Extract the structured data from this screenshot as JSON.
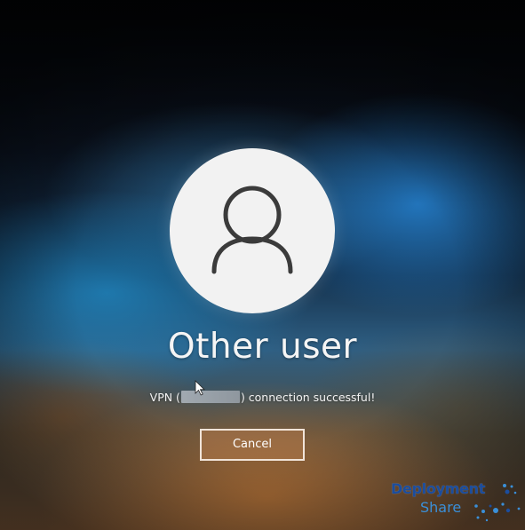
{
  "lock_screen": {
    "avatar": {
      "icon": "user-icon",
      "background_color": "#f2f2f2",
      "icon_color": "#3b3b3b"
    },
    "username": "Other user",
    "status": {
      "prefix": "VPN (",
      "redacted_value": "",
      "suffix": ") connection successful!"
    },
    "cancel_button": {
      "label": "Cancel",
      "background_color": "#b0784a"
    }
  },
  "watermark": {
    "title": "Deployment",
    "subtitle": "Share",
    "title_color": "#1b4d9e",
    "subtitle_color": "#3a8fd8"
  }
}
